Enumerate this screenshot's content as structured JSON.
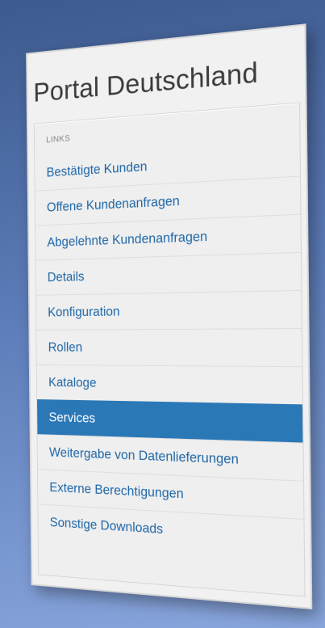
{
  "page": {
    "title": "Portal Deutschland"
  },
  "nav": {
    "header": "LINKS",
    "active_index": 7,
    "items": [
      {
        "label": "Bestätigte Kunden"
      },
      {
        "label": "Offene Kundenanfragen"
      },
      {
        "label": "Abgelehnte Kundenanfragen"
      },
      {
        "label": "Details"
      },
      {
        "label": "Konfiguration"
      },
      {
        "label": "Rollen"
      },
      {
        "label": "Kataloge"
      },
      {
        "label": "Services"
      },
      {
        "label": "Weitergabe von Datenlieferungen"
      },
      {
        "label": "Externe Berechtigungen"
      },
      {
        "label": "Sonstige Downloads"
      }
    ]
  },
  "colors": {
    "background_top": "#3d5a8e",
    "background_bottom": "#89a6dd",
    "link": "#1f67a8",
    "active_bg": "#2b78b7",
    "active_text": "#ffffff",
    "title_text": "#3c3c3c"
  }
}
